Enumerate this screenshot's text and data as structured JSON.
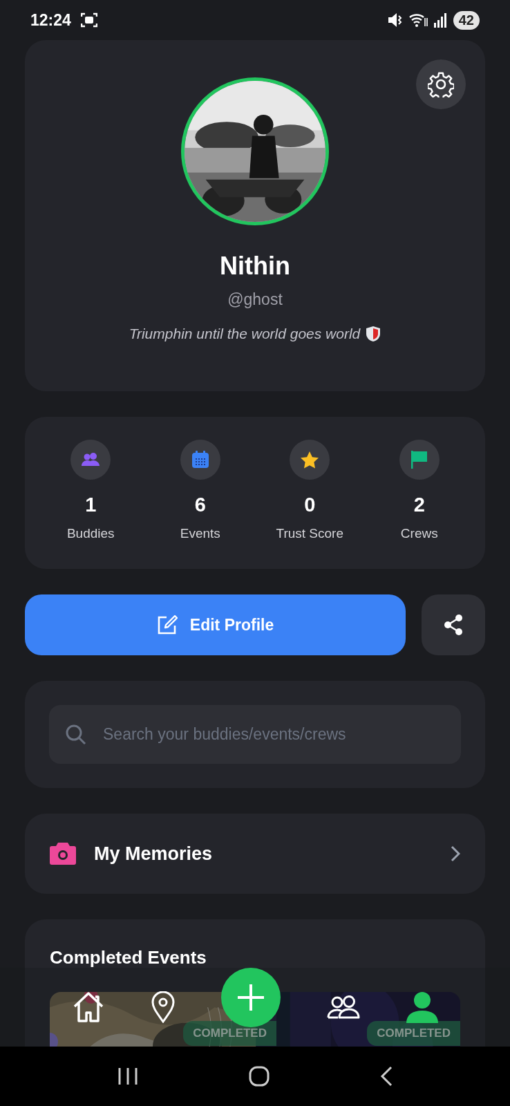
{
  "status_bar": {
    "time": "12:24",
    "battery": "42"
  },
  "profile": {
    "name": "Nithin",
    "handle": "@ghost",
    "bio": "Triumphin until the world goes world"
  },
  "stats": [
    {
      "kind": "buddies",
      "value": "1",
      "label": "Buddies"
    },
    {
      "kind": "events",
      "value": "6",
      "label": "Events"
    },
    {
      "kind": "trust",
      "value": "0",
      "label": "Trust Score"
    },
    {
      "kind": "crews",
      "value": "2",
      "label": "Crews"
    }
  ],
  "edit_button": {
    "label": "Edit Profile"
  },
  "search": {
    "placeholder": "Search your buddies/events/crews"
  },
  "memories": {
    "label": "My Memories"
  },
  "completed_events": {
    "title": "Completed Events",
    "events": [
      {
        "kind": "map",
        "badge": "COMPLETED"
      },
      {
        "kind": "night",
        "badge": "COMPLETED"
      }
    ]
  },
  "bottom_nav": [
    {
      "kind": "home",
      "selected": false
    },
    {
      "kind": "map",
      "selected": false
    },
    {
      "kind": "add",
      "selected": false
    },
    {
      "kind": "buddies",
      "selected": false
    },
    {
      "kind": "profile",
      "selected": true
    }
  ]
}
